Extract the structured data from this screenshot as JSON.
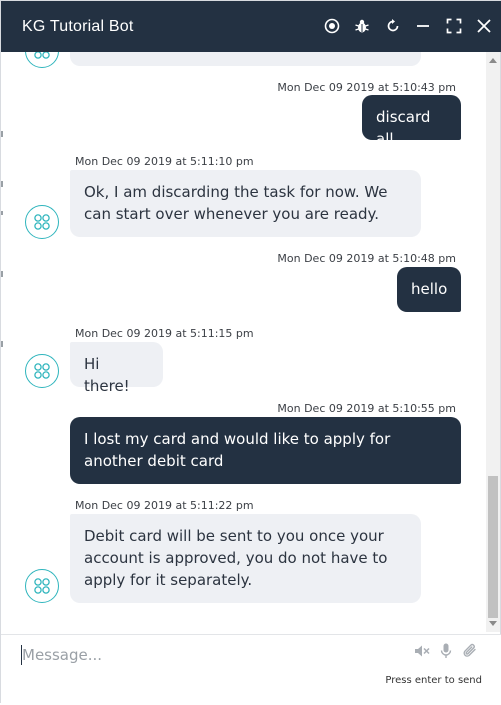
{
  "header": {
    "title": "KG Tutorial Bot",
    "icons": [
      "record-icon",
      "bug-icon",
      "refresh-icon",
      "minimize-icon",
      "expand-icon",
      "close-icon"
    ]
  },
  "messages": [
    {
      "sender": "user",
      "time": "Mon Dec 09 2019 at 5:10:43 pm",
      "text": "discard all"
    },
    {
      "sender": "bot",
      "time": "Mon Dec 09 2019 at 5:11:10 pm",
      "text": "Ok, I am discarding the task for now. We can start over whenever you are ready."
    },
    {
      "sender": "user",
      "time": "Mon Dec 09 2019 at 5:10:48 pm",
      "text": "hello"
    },
    {
      "sender": "bot",
      "time": "Mon Dec 09 2019 at 5:11:15 pm",
      "text": "Hi there!"
    },
    {
      "sender": "user",
      "time": "Mon Dec 09 2019 at 5:10:55 pm",
      "text": "I lost my card and would like to apply for another debit card"
    },
    {
      "sender": "bot",
      "time": "Mon Dec 09 2019 at 5:11:22 pm",
      "text": "Debit card will be sent to you once your account is approved, you do not have to apply for it separately."
    }
  ],
  "composer": {
    "placeholder": "Message...",
    "value": "",
    "hint": "Press enter to send",
    "icons": [
      "speaker-muted-icon",
      "microphone-icon",
      "attachment-icon"
    ]
  },
  "colors": {
    "header_bg": "#233142",
    "user_bubble": "#233142",
    "bot_bubble": "#eef0f4",
    "avatar_accent": "#2fb5bd"
  }
}
